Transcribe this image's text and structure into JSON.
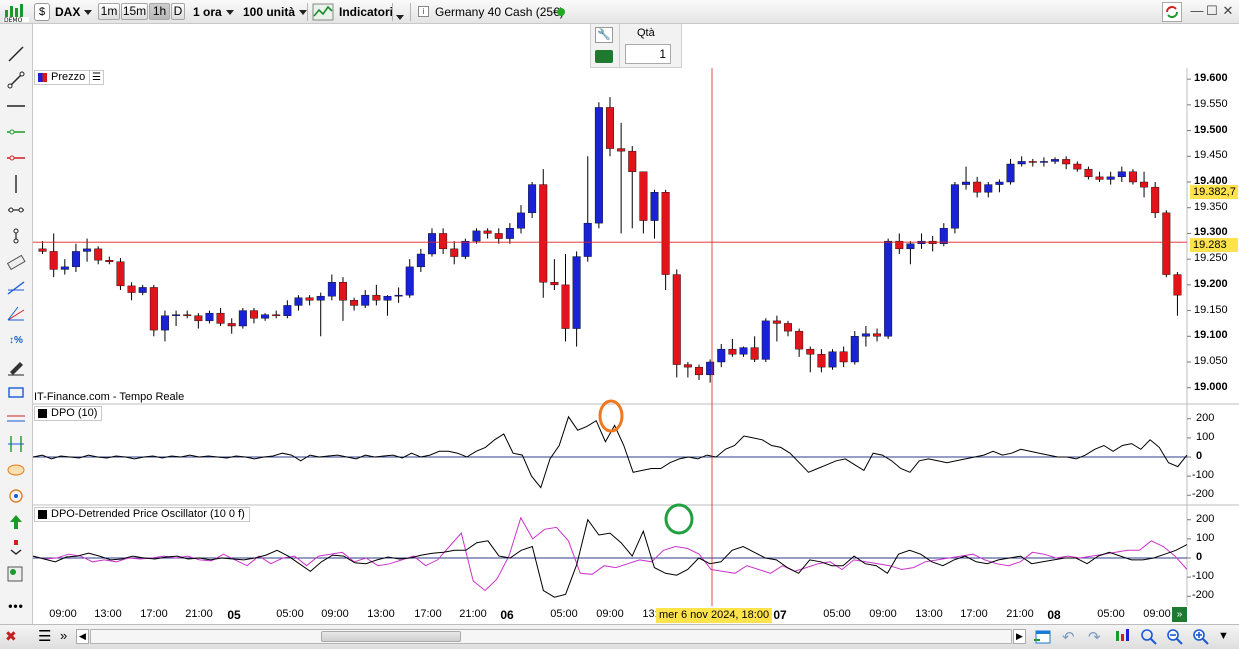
{
  "toolbar": {
    "symbol": "DAX",
    "timeframes": [
      "1m",
      "15m",
      "1h",
      "D"
    ],
    "active_timeframe": "1h",
    "period": "1 ora",
    "units": "100 unità",
    "indicators_label": "Indicatori",
    "instrument": "Germany 40 Cash (25€)",
    "status_color": "#22aa22"
  },
  "order_panel": {
    "qty_label": "Qtà",
    "qty_value": "1"
  },
  "price_pane": {
    "label": "Prezzo",
    "source": "IT-Finance.com - Tempo Reale",
    "y_ticks": [
      "19.600",
      "19.550",
      "19.500",
      "19.450",
      "19.400",
      "19.350",
      "19.300",
      "19.250",
      "19.200",
      "19.150",
      "19.100",
      "19.050",
      "19.000"
    ],
    "last_price": "19.382,7",
    "cursor_price": "19.283"
  },
  "dpo_pane": {
    "label": "DPO (10)",
    "y_ticks": [
      "200",
      "100",
      "0",
      "-100",
      "-200"
    ]
  },
  "dpo2_pane": {
    "label": "DPO-Detrended Price Oscillator (10 0 f)",
    "y_ticks": [
      "200",
      "100",
      "0",
      "-100",
      "-200"
    ]
  },
  "x_axis": {
    "labels": [
      "09:00",
      "13:00",
      "17:00",
      "21:00",
      "05",
      "05:00",
      "09:00",
      "13:00",
      "17:00",
      "21:00",
      "06",
      "05:00",
      "09:00",
      "13:",
      "07",
      "05:00",
      "09:00",
      "13:00",
      "17:00",
      "21:00",
      "08",
      "05:00",
      "09:00"
    ],
    "cursor_label": "mer 6 nov 2024, 18:00"
  },
  "colors": {
    "bull": "#1a22d6",
    "bear": "#e0141a",
    "dpo_line": "#000000",
    "dpo2_line": "#cc33cc",
    "crosshair": "#e02020",
    "highlight_orange": "#f07820",
    "highlight_green": "#22a040",
    "last_price_bg": "#ffe34d"
  },
  "chart_data": {
    "type": "candlestick",
    "title": "",
    "ylim": [
      18980,
      19610
    ],
    "candles": [
      {
        "o": 19270,
        "h": 19285,
        "l": 19260,
        "c": 19265
      },
      {
        "o": 19265,
        "h": 19300,
        "l": 19215,
        "c": 19230
      },
      {
        "o": 19230,
        "h": 19250,
        "l": 19220,
        "c": 19235
      },
      {
        "o": 19235,
        "h": 19280,
        "l": 19225,
        "c": 19265
      },
      {
        "o": 19265,
        "h": 19290,
        "l": 19245,
        "c": 19270
      },
      {
        "o": 19270,
        "h": 19275,
        "l": 19240,
        "c": 19248
      },
      {
        "o": 19248,
        "h": 19255,
        "l": 19240,
        "c": 19245
      },
      {
        "o": 19245,
        "h": 19252,
        "l": 19190,
        "c": 19198
      },
      {
        "o": 19198,
        "h": 19205,
        "l": 19170,
        "c": 19185
      },
      {
        "o": 19185,
        "h": 19200,
        "l": 19180,
        "c": 19195
      },
      {
        "o": 19195,
        "h": 19200,
        "l": 19100,
        "c": 19112
      },
      {
        "o": 19112,
        "h": 19150,
        "l": 19090,
        "c": 19140
      },
      {
        "o": 19140,
        "h": 19150,
        "l": 19120,
        "c": 19142
      },
      {
        "o": 19142,
        "h": 19150,
        "l": 19135,
        "c": 19140
      },
      {
        "o": 19140,
        "h": 19145,
        "l": 19115,
        "c": 19130
      },
      {
        "o": 19130,
        "h": 19150,
        "l": 19125,
        "c": 19145
      },
      {
        "o": 19145,
        "h": 19155,
        "l": 19120,
        "c": 19125
      },
      {
        "o": 19125,
        "h": 19135,
        "l": 19105,
        "c": 19120
      },
      {
        "o": 19120,
        "h": 19155,
        "l": 19115,
        "c": 19150
      },
      {
        "o": 19150,
        "h": 19155,
        "l": 19125,
        "c": 19135
      },
      {
        "o": 19135,
        "h": 19145,
        "l": 19130,
        "c": 19142
      },
      {
        "o": 19142,
        "h": 19150,
        "l": 19135,
        "c": 19140
      },
      {
        "o": 19140,
        "h": 19170,
        "l": 19135,
        "c": 19160
      },
      {
        "o": 19160,
        "h": 19180,
        "l": 19150,
        "c": 19175
      },
      {
        "o": 19175,
        "h": 19180,
        "l": 19160,
        "c": 19170
      },
      {
        "o": 19170,
        "h": 19185,
        "l": 19100,
        "c": 19178
      },
      {
        "o": 19178,
        "h": 19220,
        "l": 19170,
        "c": 19205
      },
      {
        "o": 19205,
        "h": 19215,
        "l": 19130,
        "c": 19170
      },
      {
        "o": 19170,
        "h": 19175,
        "l": 19150,
        "c": 19160
      },
      {
        "o": 19160,
        "h": 19190,
        "l": 19155,
        "c": 19180
      },
      {
        "o": 19180,
        "h": 19200,
        "l": 19160,
        "c": 19170
      },
      {
        "o": 19170,
        "h": 19180,
        "l": 19140,
        "c": 19178
      },
      {
        "o": 19178,
        "h": 19195,
        "l": 19165,
        "c": 19180
      },
      {
        "o": 19180,
        "h": 19250,
        "l": 19175,
        "c": 19235
      },
      {
        "o": 19235,
        "h": 19270,
        "l": 19225,
        "c": 19260
      },
      {
        "o": 19260,
        "h": 19310,
        "l": 19255,
        "c": 19300
      },
      {
        "o": 19300,
        "h": 19310,
        "l": 19260,
        "c": 19270
      },
      {
        "o": 19270,
        "h": 19285,
        "l": 19240,
        "c": 19255
      },
      {
        "o": 19255,
        "h": 19290,
        "l": 19250,
        "c": 19285
      },
      {
        "o": 19285,
        "h": 19310,
        "l": 19280,
        "c": 19305
      },
      {
        "o": 19305,
        "h": 19310,
        "l": 19290,
        "c": 19300
      },
      {
        "o": 19300,
        "h": 19310,
        "l": 19280,
        "c": 19290
      },
      {
        "o": 19290,
        "h": 19320,
        "l": 19280,
        "c": 19310
      },
      {
        "o": 19310,
        "h": 19355,
        "l": 19300,
        "c": 19340
      },
      {
        "o": 19340,
        "h": 19400,
        "l": 19330,
        "c": 19395
      },
      {
        "o": 19395,
        "h": 19425,
        "l": 19175,
        "c": 19205
      },
      {
        "o": 19205,
        "h": 19250,
        "l": 19190,
        "c": 19200
      },
      {
        "o": 19200,
        "h": 19260,
        "l": 19090,
        "c": 19115
      },
      {
        "o": 19115,
        "h": 19265,
        "l": 19080,
        "c": 19255
      },
      {
        "o": 19255,
        "h": 19450,
        "l": 19245,
        "c": 19320
      },
      {
        "o": 19320,
        "h": 19555,
        "l": 19310,
        "c": 19545
      },
      {
        "o": 19545,
        "h": 19565,
        "l": 19450,
        "c": 19465
      },
      {
        "o": 19465,
        "h": 19515,
        "l": 19300,
        "c": 19460
      },
      {
        "o": 19460,
        "h": 19470,
        "l": 19310,
        "c": 19420
      },
      {
        "o": 19420,
        "h": 19420,
        "l": 19300,
        "c": 19325
      },
      {
        "o": 19325,
        "h": 19385,
        "l": 19290,
        "c": 19380
      },
      {
        "o": 19380,
        "h": 19385,
        "l": 19190,
        "c": 19220
      },
      {
        "o": 19220,
        "h": 19230,
        "l": 19020,
        "c": 19045
      },
      {
        "o": 19045,
        "h": 19050,
        "l": 19020,
        "c": 19040
      },
      {
        "o": 19040,
        "h": 19045,
        "l": 19015,
        "c": 19025
      },
      {
        "o": 19025,
        "h": 19055,
        "l": 19010,
        "c": 19050
      },
      {
        "o": 19050,
        "h": 19085,
        "l": 19040,
        "c": 19075
      },
      {
        "o": 19075,
        "h": 19095,
        "l": 19060,
        "c": 19065
      },
      {
        "o": 19065,
        "h": 19080,
        "l": 19060,
        "c": 19078
      },
      {
        "o": 19078,
        "h": 19100,
        "l": 19050,
        "c": 19055
      },
      {
        "o": 19055,
        "h": 19135,
        "l": 19050,
        "c": 19130
      },
      {
        "o": 19130,
        "h": 19140,
        "l": 19090,
        "c": 19125
      },
      {
        "o": 19125,
        "h": 19130,
        "l": 19100,
        "c": 19110
      },
      {
        "o": 19110,
        "h": 19115,
        "l": 19060,
        "c": 19075
      },
      {
        "o": 19075,
        "h": 19080,
        "l": 19030,
        "c": 19065
      },
      {
        "o": 19065,
        "h": 19075,
        "l": 19030,
        "c": 19040
      },
      {
        "o": 19040,
        "h": 19075,
        "l": 19035,
        "c": 19070
      },
      {
        "o": 19070,
        "h": 19080,
        "l": 19040,
        "c": 19050
      },
      {
        "o": 19050,
        "h": 19110,
        "l": 19045,
        "c": 19100
      },
      {
        "o": 19100,
        "h": 19120,
        "l": 19080,
        "c": 19105
      },
      {
        "o": 19105,
        "h": 19115,
        "l": 19090,
        "c": 19100
      },
      {
        "o": 19100,
        "h": 19290,
        "l": 19095,
        "c": 19285
      },
      {
        "o": 19285,
        "h": 19300,
        "l": 19260,
        "c": 19270
      },
      {
        "o": 19270,
        "h": 19285,
        "l": 19240,
        "c": 19280
      },
      {
        "o": 19280,
        "h": 19300,
        "l": 19270,
        "c": 19285
      },
      {
        "o": 19285,
        "h": 19295,
        "l": 19265,
        "c": 19280
      },
      {
        "o": 19280,
        "h": 19320,
        "l": 19275,
        "c": 19310
      },
      {
        "o": 19310,
        "h": 19400,
        "l": 19300,
        "c": 19395
      },
      {
        "o": 19395,
        "h": 19430,
        "l": 19385,
        "c": 19400
      },
      {
        "o": 19400,
        "h": 19410,
        "l": 19370,
        "c": 19380
      },
      {
        "o": 19380,
        "h": 19400,
        "l": 19370,
        "c": 19395
      },
      {
        "o": 19395,
        "h": 19405,
        "l": 19380,
        "c": 19400
      },
      {
        "o": 19400,
        "h": 19445,
        "l": 19395,
        "c": 19435
      },
      {
        "o": 19435,
        "h": 19450,
        "l": 19430,
        "c": 19440
      },
      {
        "o": 19440,
        "h": 19445,
        "l": 19430,
        "c": 19438
      },
      {
        "o": 19438,
        "h": 19448,
        "l": 19430,
        "c": 19440
      },
      {
        "o": 19440,
        "h": 19448,
        "l": 19435,
        "c": 19444
      },
      {
        "o": 19444,
        "h": 19450,
        "l": 19425,
        "c": 19435
      },
      {
        "o": 19435,
        "h": 19440,
        "l": 19420,
        "c": 19425
      },
      {
        "o": 19425,
        "h": 19430,
        "l": 19405,
        "c": 19410
      },
      {
        "o": 19410,
        "h": 19420,
        "l": 19400,
        "c": 19405
      },
      {
        "o": 19405,
        "h": 19420,
        "l": 19395,
        "c": 19410
      },
      {
        "o": 19410,
        "h": 19430,
        "l": 19400,
        "c": 19420
      },
      {
        "o": 19420,
        "h": 19425,
        "l": 19395,
        "c": 19400
      },
      {
        "o": 19400,
        "h": 19420,
        "l": 19370,
        "c": 19390
      },
      {
        "o": 19390,
        "h": 19400,
        "l": 19330,
        "c": 19340
      },
      {
        "o": 19340,
        "h": 19345,
        "l": 19215,
        "c": 19220
      },
      {
        "o": 19220,
        "h": 19225,
        "l": 19140,
        "c": 19180
      }
    ],
    "dpo_values": [
      0,
      10,
      -10,
      5,
      0,
      -5,
      10,
      0,
      -5,
      5,
      0,
      -10,
      0,
      5,
      -5,
      5,
      0,
      10,
      0,
      5,
      0,
      -5,
      5,
      0,
      -10,
      0,
      5,
      20,
      10,
      -20,
      10,
      0,
      5,
      10,
      0,
      -10,
      10,
      0,
      5,
      10,
      -5,
      20,
      0,
      10,
      30,
      30,
      20,
      0,
      30,
      50,
      90,
      120,
      20,
      10,
      -100,
      -160,
      -10,
      60,
      210,
      140,
      160,
      190,
      80,
      165,
      60,
      -80,
      -70,
      -60,
      -60,
      -30,
      -10,
      0,
      -10,
      10,
      0,
      40,
      60,
      110,
      100,
      90,
      60,
      50,
      20,
      -30,
      -80,
      -60,
      -40,
      -20,
      -10,
      -40,
      -70,
      20,
      10,
      -20,
      -60,
      -80,
      -20,
      -10,
      -20,
      -30,
      -20,
      -10,
      0,
      10,
      30,
      10,
      20,
      40,
      30,
      20,
      10,
      0,
      0,
      -10,
      10,
      40,
      60,
      30,
      60,
      70,
      40,
      90,
      50,
      -30,
      -50,
      10
    ],
    "dpo2_black": [
      10,
      -5,
      -20,
      5,
      10,
      25,
      10,
      -10,
      -5,
      10,
      0,
      -5,
      5,
      10,
      -5,
      0,
      -10,
      0,
      -5,
      -10,
      0,
      15,
      40,
      10,
      -30,
      -70,
      -20,
      15,
      10,
      -25,
      -30,
      -10,
      5,
      -5,
      0,
      15,
      25,
      30,
      40,
      40,
      80,
      90,
      10,
      0,
      40,
      60,
      -170,
      -205,
      -190,
      -35,
      200,
      120,
      130,
      80,
      10,
      140,
      -50,
      -80,
      -90,
      -60,
      0,
      -30,
      -20,
      40,
      60,
      30,
      0,
      -10,
      -50,
      -80,
      -10,
      -20,
      -40,
      -40,
      10,
      -30,
      -40,
      -80,
      20,
      40,
      20,
      -20,
      -40,
      -10,
      10,
      -20,
      -30,
      -10,
      0,
      10,
      -30,
      -20,
      -10,
      0,
      0,
      -30,
      10,
      30,
      10,
      -10,
      -10,
      0,
      20,
      40,
      70
    ],
    "dpo2_magenta": [
      10,
      -5,
      0,
      20,
      10,
      -20,
      -10,
      -20,
      0,
      -5,
      0,
      10,
      0,
      10,
      -10,
      -15,
      20,
      -10,
      -40,
      10,
      -30,
      0,
      10,
      -40,
      10,
      20,
      30,
      -20,
      0,
      -40,
      -30,
      -10,
      10,
      -40,
      -10,
      60,
      130,
      -120,
      -170,
      -110,
      10,
      210,
      100,
      150,
      160,
      90,
      -80,
      -85,
      -40,
      -50,
      -30,
      -10,
      -20,
      40,
      60,
      50,
      20,
      -60,
      -70,
      -80,
      -40,
      -60,
      -80,
      -40,
      -70,
      -50,
      -30,
      -20,
      -60,
      -10,
      -20,
      -30,
      -40,
      -60,
      -50,
      -20,
      -10,
      0,
      10,
      20,
      -10,
      -30,
      -40,
      -20,
      30,
      20,
      0,
      10,
      0,
      10,
      20,
      30,
      40,
      40,
      90,
      60,
      10,
      -60
    ]
  }
}
